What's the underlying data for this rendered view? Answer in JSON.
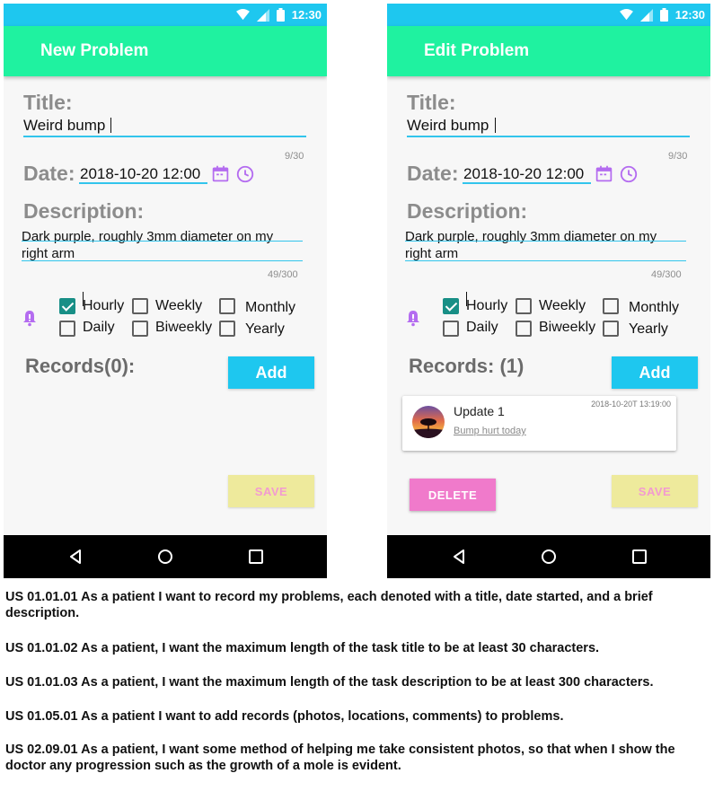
{
  "status_bar": {
    "time": "12:30",
    "icons": [
      "wifi-icon",
      "signal-icon",
      "battery-icon"
    ]
  },
  "screen_new": {
    "app_title": "New Problem",
    "title_label": "Title:",
    "title_value": "Weird bump",
    "title_counter": "9/30",
    "date_label": "Date:",
    "date_value": "2018-10-20 12:00",
    "description_label": "Description:",
    "description_line_1": "Dark purple, roughly 3mm diameter on my",
    "description_line_2": "right arm",
    "description_counter": "49/300",
    "reminder": {
      "hourly": "Hourly",
      "weekly": "Weekly",
      "monthly": "Monthly",
      "daily": "Daily",
      "biweekly": "Biweekly",
      "yearly": "Yearly",
      "checked": [
        "Hourly"
      ]
    },
    "records_label": "Records(0):",
    "add_label": "Add",
    "save_label": "SAVE"
  },
  "screen_edit": {
    "app_title": "Edit Problem",
    "title_label": "Title:",
    "title_value": "Weird bump",
    "title_counter": "9/30",
    "date_label": "Date:",
    "date_value": "2018-10-20 12:00",
    "description_label": "Description:",
    "description_line_1": "Dark purple, roughly 3mm diameter on my",
    "description_line_2": "right arm",
    "description_counter": "49/300",
    "reminder": {
      "hourly": "Hourly",
      "weekly": "Weekly",
      "monthly": "Monthly",
      "daily": "Daily",
      "biweekly": "Biweekly",
      "yearly": "Yearly",
      "checked": [
        "Hourly"
      ]
    },
    "records_label": "Records: (1)",
    "add_label": "Add",
    "record": {
      "title": "Update 1",
      "comment": "Bump hurt today",
      "timestamp": "2018-10-20T 13:19:00"
    },
    "delete_label": "DELETE",
    "save_label": "SAVE"
  },
  "user_stories": [
    "US 01.01.01 As a patient I want to record my problems, each denoted with a title, date started, and a brief description.",
    "US 01.01.02 As a patient, I want the maximum length of the task title to be at least 30 characters.",
    "US 01.01.03 As a patient, I want the maximum length of the task description to be at least 300 characters.",
    "US 01.05.01 As a patient I want to add records (photos, locations, comments) to problems.",
    "US 02.09.01 As a patient, I want some method of helping me take consistent photos, so that when I show the doctor any progression such as the growth of a mole is evident."
  ],
  "colors": {
    "status_bar": "#1ec7ef",
    "app_bar": "#1ff2a0",
    "accent_blue": "#1ec7ef",
    "checkbox_checked": "#188f86",
    "icon_purple": "#b46cf0",
    "save_button": "#eeea9c",
    "delete_button": "#f07acb"
  }
}
